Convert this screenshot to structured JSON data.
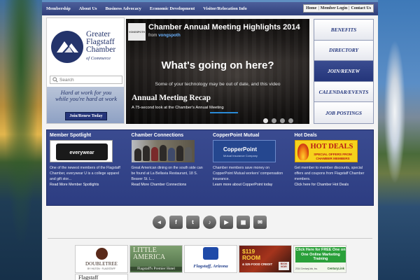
{
  "nav": {
    "items": [
      "Membership",
      "About Us",
      "Business Advocacy",
      "Economic Development",
      "Visitor/Relocation Info"
    ],
    "util": [
      "Home",
      "Member Login",
      "Contact Us"
    ]
  },
  "logo": {
    "line1": "Greater",
    "line2": "Flagstaff",
    "line3": "Chamber",
    "sub": "of Commerce"
  },
  "search": {
    "placeholder": "Search"
  },
  "tagline": {
    "line1": "Hard at work for you",
    "line2": "while you're hard at work",
    "button": "Join/Renew Today"
  },
  "video": {
    "channel_avatar": "VONGSPOTH",
    "title": "Chamber Annual Meeting Highlights 2014",
    "from_label": "from",
    "from_user": "vongspoth",
    "headline": "What's going on here?",
    "warning": "Some of your technology may be out of date, and this video",
    "recap_title": "Annual Meeting Recap",
    "recap_sub": "A 75-second look at the Chamber's Annual Meeting",
    "active_slide": 1,
    "slides": 4
  },
  "side_menu": {
    "items": [
      "BENEFITS",
      "DIRECTORY",
      "JOIN/RENEW",
      "CALENDAR/EVENTS",
      "JOB POSTINGS"
    ],
    "active": "JOIN/RENEW"
  },
  "features": [
    {
      "title": "Member Spotlight",
      "thumb": "everywear",
      "body": "One of the newest members of the Flagstaff Chamber, everywear U is a college apparel and gift stor...",
      "link": "Read More Member Spotlights"
    },
    {
      "title": "Chamber Connections",
      "thumb": "",
      "body": "Great American dining on the south side can be found at La Bellavia Restaurant, 18 S. Beaver St. L...",
      "link": "Read More Chamber Connections"
    },
    {
      "title": "CopperPoint Mutual",
      "thumb": "CopperPoint",
      "thumb_sub": "Mutual Insurance Company",
      "body": "Chamber members save money on CopperPoint Mutual workers' compensation insurance.",
      "link": "Learn more about CopperPoint today"
    },
    {
      "title": "Hot Deals",
      "thumb": "HOT DEALS",
      "thumb_sub": "SPECIAL OFFERS FROM CHAMBER MEMBERS",
      "body": "Get member to member discounts, special offers and coupons from Flagstaff Chamber members.",
      "link": "Click here for Chamber Hot Deals"
    }
  ],
  "social": [
    "megaphone-icon",
    "facebook-icon",
    "twitter-icon",
    "microphone-icon",
    "youtube-icon",
    "tickets-icon",
    "mail-icon"
  ],
  "social_glyphs": [
    "◄",
    "f",
    "t",
    "♪",
    "▶",
    "▦",
    "✉"
  ],
  "sponsors": {
    "doubletree": {
      "name": "DOUBLETREE",
      "sub": "BY HILTON · FLAGSTAFF"
    },
    "little_america": {
      "name1": "LITTLE",
      "name2": "AMERICA",
      "sub": "Flagstaff's Premier Hotel"
    },
    "comfort": {
      "name": "Flagstaff, Arizona"
    },
    "room": {
      "line1": "$119",
      "line2": "ROOM",
      "line3": "& $25 FOOD CREDIT",
      "book": "BOOK NOW!"
    },
    "century": {
      "banner": "Click Here for FREE One on One Online Marketing Training",
      "fine": "2014 CenturyLink, Inc.",
      "brand": "CenturyLink"
    },
    "flagstaff": "Flagstaff"
  }
}
